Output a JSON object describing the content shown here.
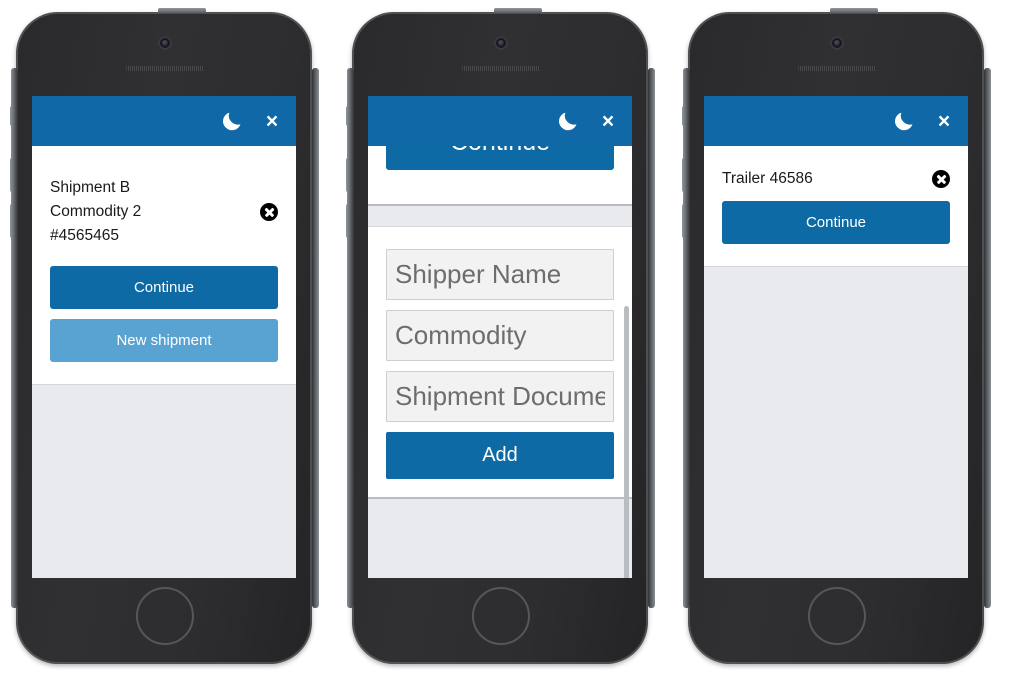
{
  "app": {
    "accent_blue": "#1069a6",
    "button_primary": "#0d6aa4",
    "button_secondary": "#59a3d3",
    "panel_gray": "#e8eaed",
    "moon_icon": "moon-icon",
    "close_icon": "×"
  },
  "phones": [
    {
      "id": "phone-1",
      "screen": {
        "card_text": "Shipment B\nCommodity 2\n#4565465",
        "dismiss_icon": "x-circle-icon",
        "buttons": [
          {
            "label": "Continue",
            "style": "primary"
          },
          {
            "label": "New shipment",
            "style": "secondary"
          }
        ]
      }
    },
    {
      "id": "phone-2",
      "screen": {
        "scrolled_button_label": "Continue",
        "fields": [
          {
            "placeholder": "Shipper Name",
            "value": ""
          },
          {
            "placeholder": "Commodity",
            "value": ""
          },
          {
            "placeholder": "Shipment Document",
            "value": ""
          }
        ],
        "add_button_label": "Add"
      }
    },
    {
      "id": "phone-3",
      "screen": {
        "card_text": "Trailer 46586",
        "dismiss_icon": "x-circle-icon",
        "buttons": [
          {
            "label": "Continue",
            "style": "primary"
          }
        ]
      }
    }
  ]
}
